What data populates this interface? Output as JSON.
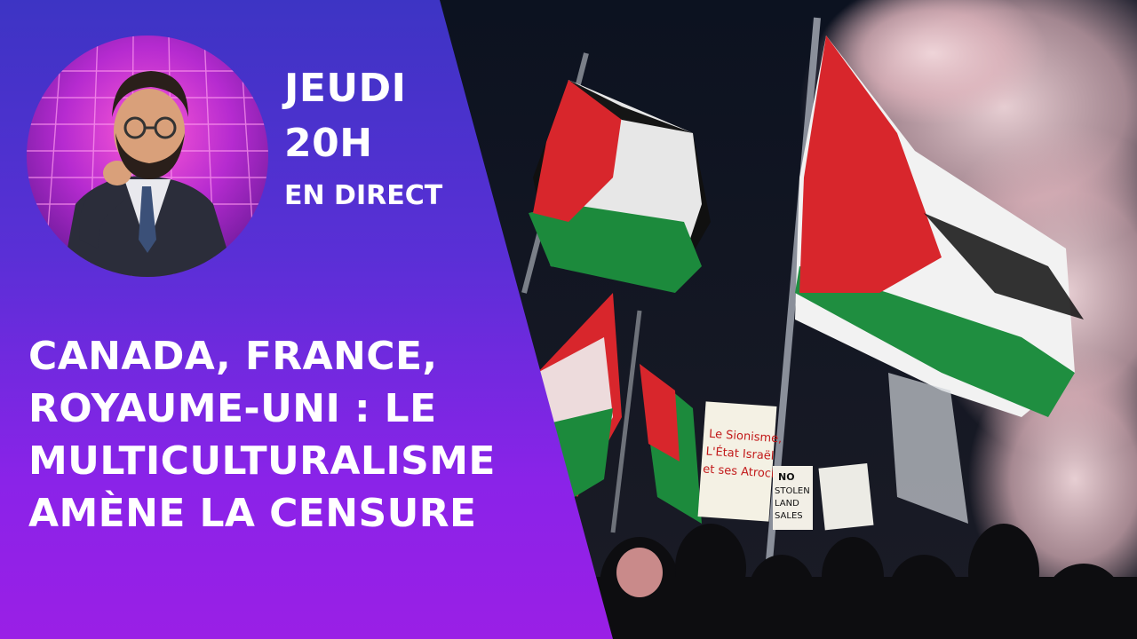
{
  "schedule": {
    "day": "JEUDI",
    "time": "20H",
    "live": "EN DIRECT"
  },
  "headline": {
    "lines": [
      "CANADA, FRANCE,",
      "ROYAUME-UNI : LE",
      "MULTICULTURALISME",
      "AMÈNE LA CENSURE"
    ]
  },
  "photo": {
    "signs": {
      "sign1": [
        "Le Sionisme,",
        "L'État Israël",
        "et ses Atrocités"
      ],
      "sign2": [
        "NO",
        "STOLEN",
        "LAND",
        "SALES"
      ]
    }
  },
  "colors": {
    "panel_top": "#3d34c4",
    "panel_bottom": "#9a1fe6",
    "text": "#ffffff",
    "flag_red": "#d8262c",
    "flag_green": "#1c8a3c"
  }
}
